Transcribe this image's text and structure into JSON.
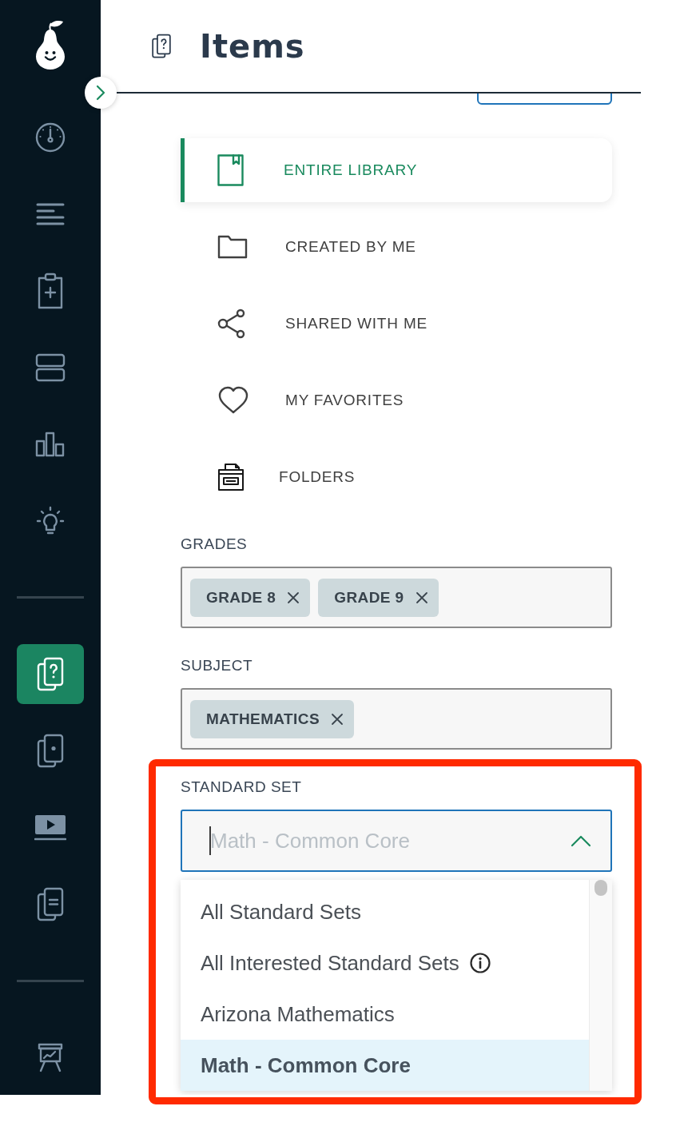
{
  "sidebar": {
    "groups": [
      [
        {
          "selected": false
        },
        {
          "selected": false
        },
        {
          "selected": false
        },
        {
          "selected": false
        },
        {
          "selected": false
        },
        {
          "selected": false
        }
      ],
      [
        {
          "selected": true
        },
        {
          "selected": false
        },
        {
          "selected": false
        },
        {
          "selected": false
        }
      ],
      [
        {
          "selected": false
        }
      ]
    ]
  },
  "header": {
    "title": "Items"
  },
  "library_nav": {
    "items": [
      {
        "label": "ENTIRE LIBRARY",
        "selected": true
      },
      {
        "label": "CREATED BY ME",
        "selected": false
      },
      {
        "label": "SHARED WITH ME",
        "selected": false
      },
      {
        "label": "MY FAVORITES",
        "selected": false
      },
      {
        "label": "FOLDERS",
        "selected": false
      }
    ]
  },
  "filters": [
    {
      "kind": "tags",
      "label": "GRADES",
      "chips": [
        "GRADE 8",
        "GRADE 9"
      ]
    },
    {
      "kind": "tags",
      "label": "SUBJECT",
      "chips": [
        "MATHEMATICS"
      ]
    },
    {
      "kind": "select",
      "label": "STANDARD SET",
      "placeholder": "Math - Common Core",
      "focused": true,
      "expanded": true,
      "highlighted": true,
      "options": [
        {
          "label": "All Standard Sets",
          "info": false,
          "selected": false
        },
        {
          "label": "All Interested Standard Sets",
          "info": true,
          "selected": false
        },
        {
          "label": "Arizona Mathematics",
          "info": false,
          "selected": false
        },
        {
          "label": "Math - Common Core",
          "info": false,
          "selected": true
        }
      ]
    }
  ]
}
